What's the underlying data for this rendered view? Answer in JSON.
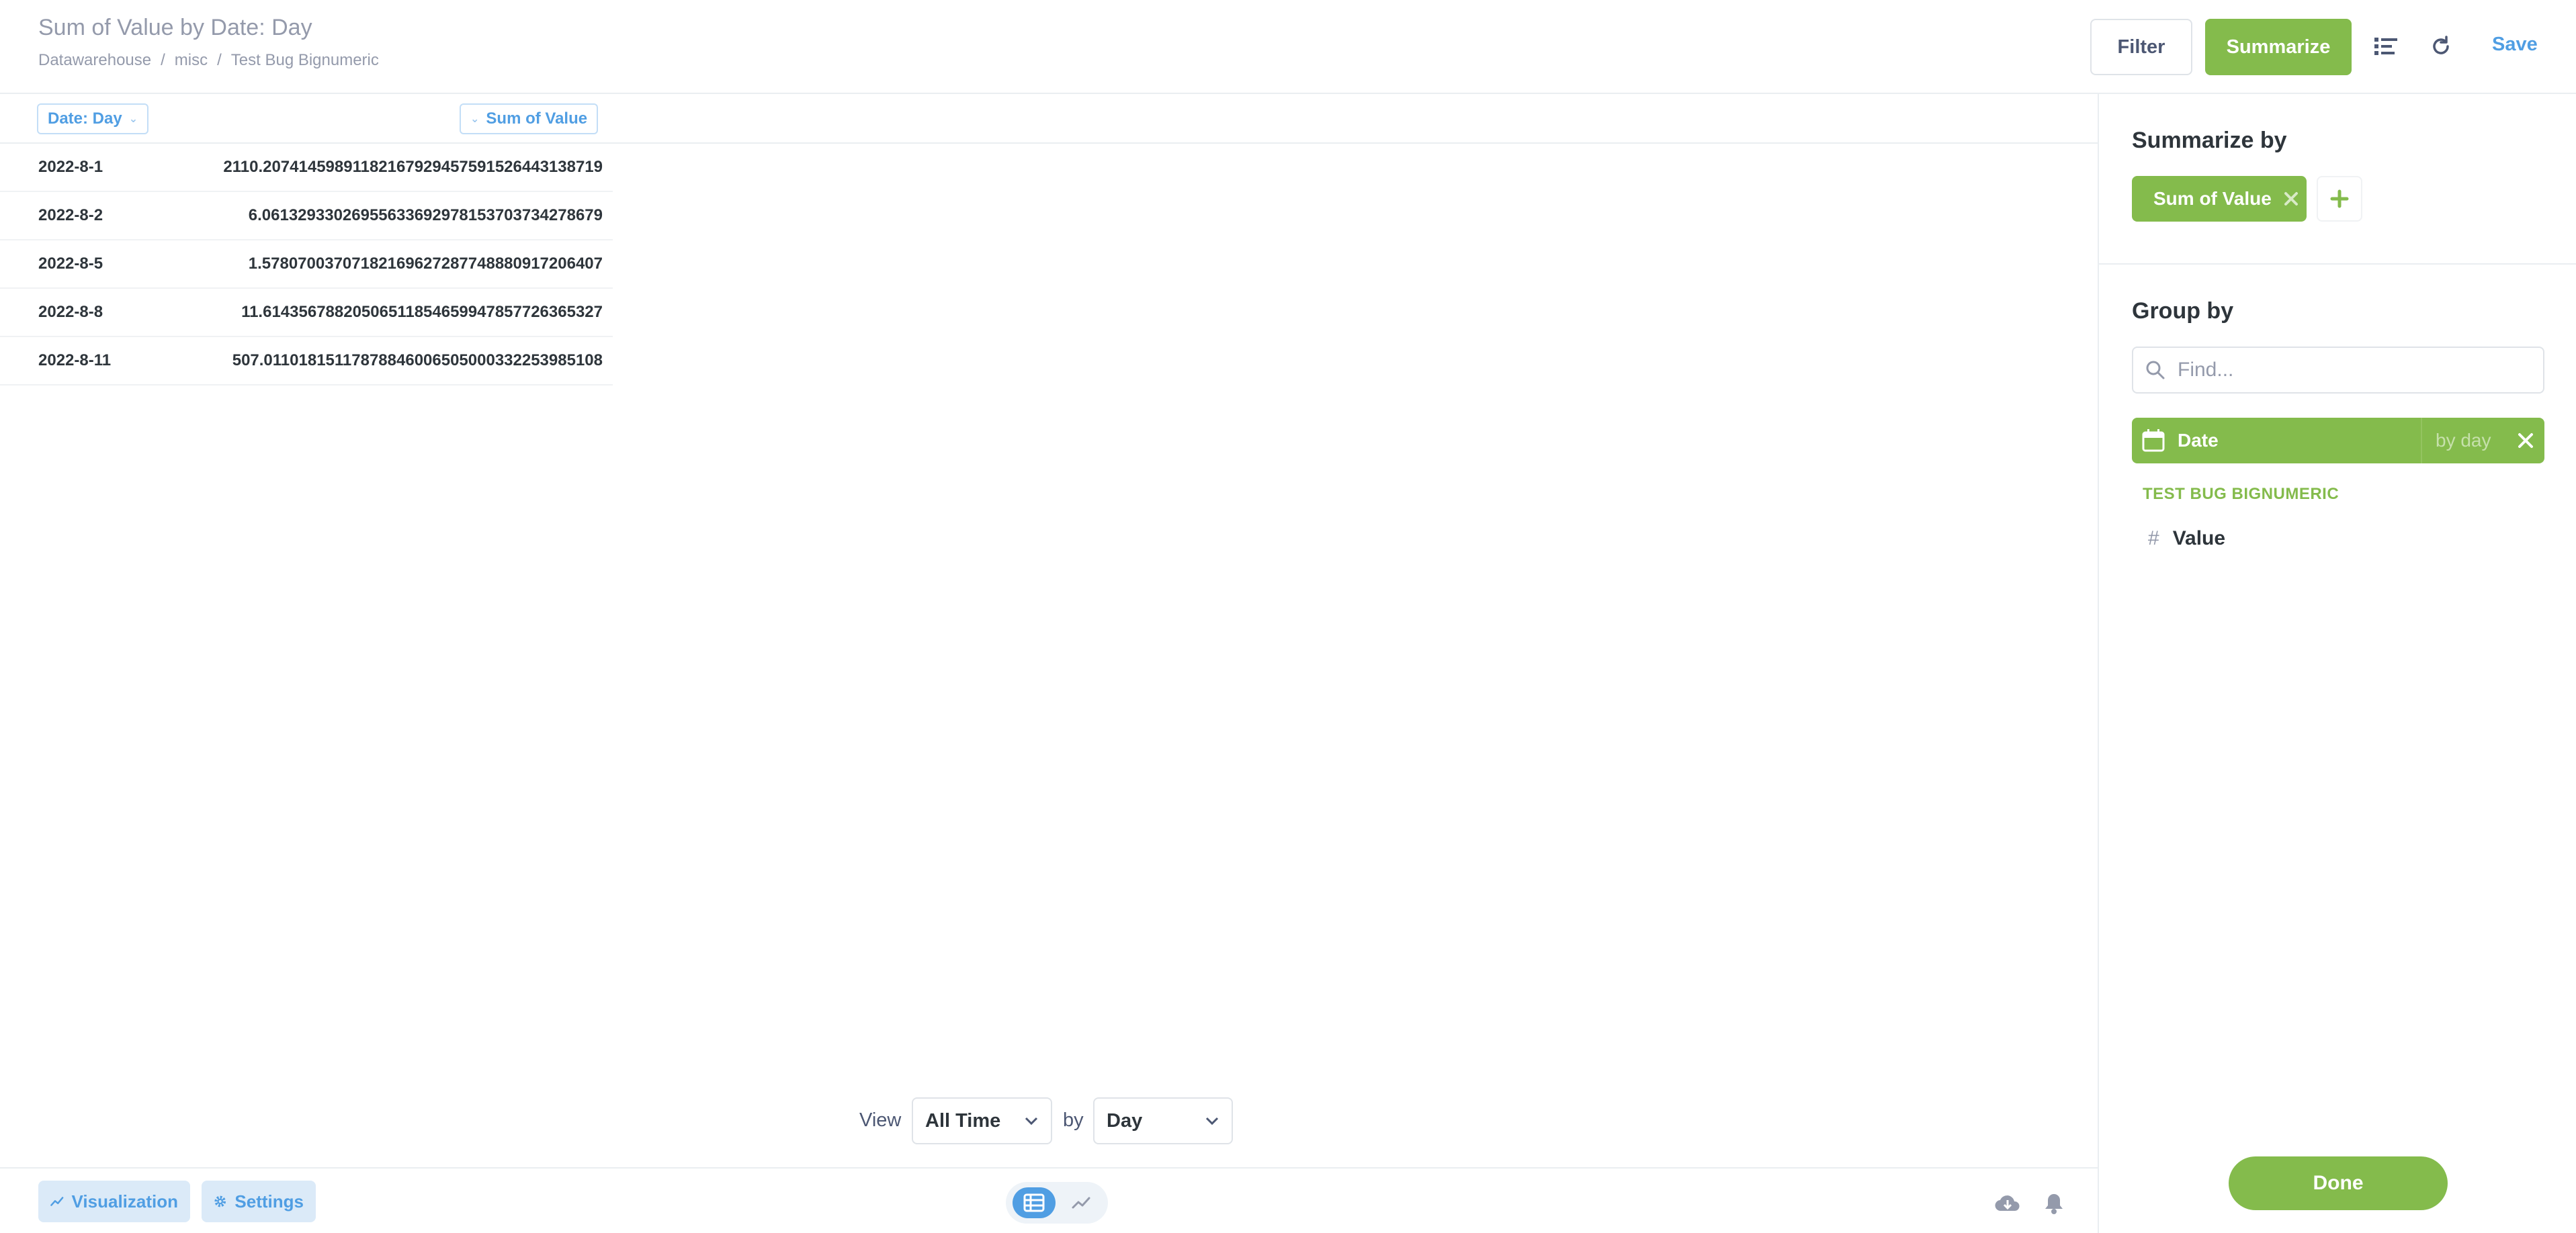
{
  "header": {
    "title": "Sum of Value by Date: Day",
    "breadcrumb": [
      "Datawarehouse",
      "misc",
      "Test Bug Bignumeric"
    ],
    "breadcrumb_separator": "/",
    "filter_label": "Filter",
    "summarize_label": "Summarize",
    "save_label": "Save",
    "notebook_icon": "list-icon",
    "refresh_icon": "refresh-icon"
  },
  "table": {
    "columns": [
      "Date: Day",
      "Sum of Value"
    ],
    "rows": [
      [
        "2022-8-1",
        "2110.20741459891182167929457591526443138719"
      ],
      [
        "2022-8-2",
        "6.06132933026955633692978153703734278679"
      ],
      [
        "2022-8-5",
        "1.57807003707182169627287748880917206407"
      ],
      [
        "2022-8-8",
        "11.61435678820506511854659947857726365327"
      ],
      [
        "2022-8-11",
        "507.01101815117878846006505000332253985108"
      ]
    ]
  },
  "viewbar": {
    "view_label": "View",
    "time_value": "All Time",
    "by_label": "by",
    "granularity_value": "Day"
  },
  "footer": {
    "visualization_label": "Visualization",
    "settings_label": "Settings",
    "download_icon": "cloud-download-icon",
    "alert_icon": "bell-icon"
  },
  "sidebar": {
    "summarize_title": "Summarize by",
    "metric_label": "Sum of Value",
    "group_title": "Group by",
    "find_placeholder": "Find...",
    "dimension_name": "Date",
    "dimension_bucket": "by day",
    "table_name": "TEST BUG BIGNUMERIC",
    "field_label": "Value",
    "field_type_symbol": "#",
    "done_label": "Done"
  },
  "colors": {
    "accent_green": "#84bb4c",
    "brand_blue": "#509ee3",
    "muted_text": "#949aab"
  }
}
